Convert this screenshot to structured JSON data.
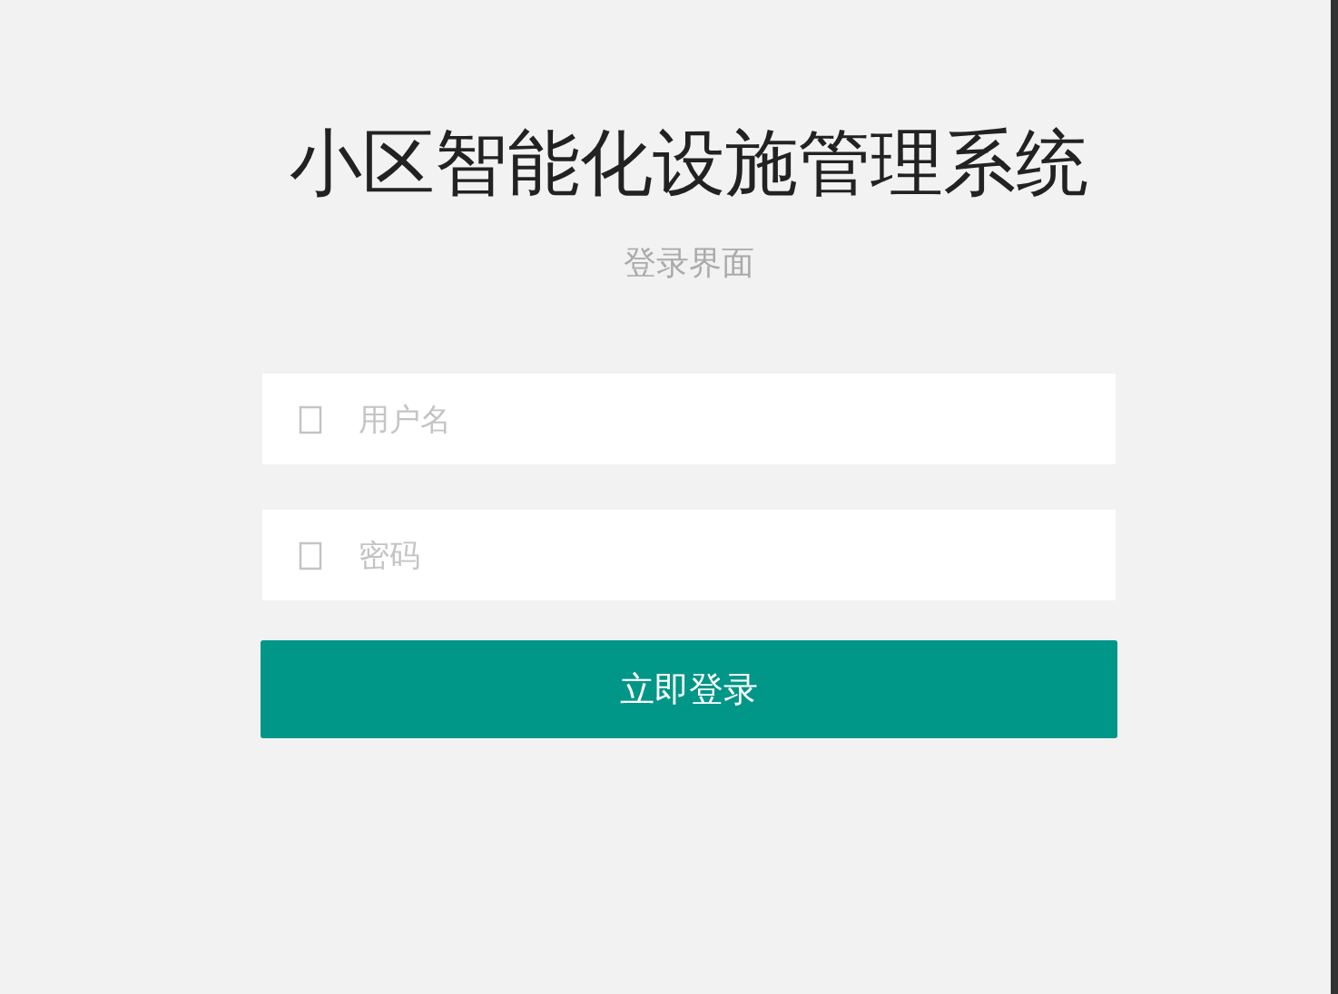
{
  "title": "小区智能化设施管理系统",
  "subtitle": "登录界面",
  "fields": [
    {
      "placeholder": "用户名"
    },
    {
      "placeholder": "密码"
    }
  ],
  "submit": "立即登录"
}
